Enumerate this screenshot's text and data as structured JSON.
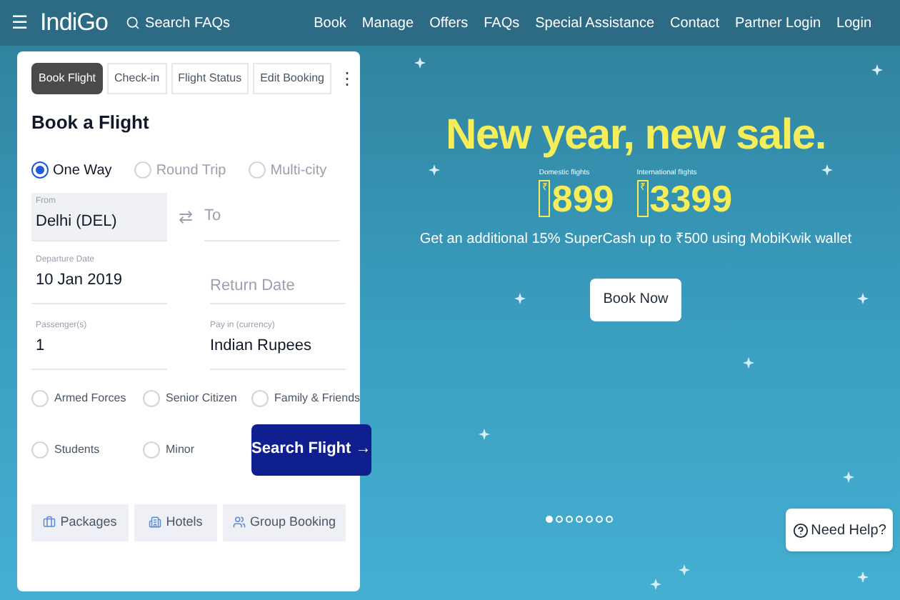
{
  "header": {
    "menu": "☰",
    "logo": "IndiGo",
    "search": "Search FAQs",
    "nav": [
      "Book",
      "Manage",
      "Offers",
      "FAQs",
      "Special Assistance",
      "Contact",
      "Partner Login",
      "Login"
    ]
  },
  "booking": {
    "tabs": [
      {
        "label": "Book Flight",
        "selected": true
      },
      {
        "label": "Check-in",
        "selected": false
      },
      {
        "label": "Flight Status",
        "selected": false
      },
      {
        "label": "Edit Booking",
        "selected": false
      }
    ],
    "more": "⋮",
    "title": "Book a Flight",
    "trip_types": [
      {
        "label": "One Way",
        "selected": true
      },
      {
        "label": "Round Trip",
        "selected": false
      },
      {
        "label": "Multi-city",
        "selected": false
      }
    ],
    "from": {
      "label": "From",
      "value": "Delhi (DEL)"
    },
    "swap": "⇄",
    "to": {
      "placeholder": "To"
    },
    "departure": {
      "label": "Departure Date",
      "value": "10 Jan 2019"
    },
    "return": {
      "placeholder": "Return Date"
    },
    "passengers": {
      "label": "Passenger(s)",
      "value": "1"
    },
    "currency": {
      "label": "Pay in (currency)",
      "value": "Indian Rupees"
    },
    "fare_types": [
      {
        "label": "Armed Forces",
        "selected": false
      },
      {
        "label": "Senior Citizen",
        "selected": false
      },
      {
        "label": "Family & Friends",
        "selected": false
      },
      {
        "label": "Students",
        "selected": false
      },
      {
        "label": "Minor",
        "selected": false
      }
    ],
    "search_button": "Search Flight →",
    "links": [
      {
        "label": "Packages",
        "kind": "suitcase"
      },
      {
        "label": "Hotels",
        "kind": "building"
      },
      {
        "label": "Group Booking",
        "kind": "group"
      }
    ]
  },
  "banner": {
    "headline": "New year, new sale.",
    "prices": [
      {
        "caption": "Domestic flights",
        "currency": "₹",
        "amount": "899"
      },
      {
        "caption": "International flights",
        "currency": "₹",
        "amount": "3399"
      }
    ],
    "offer": "Get an additional 15% SuperCash up to ₹500 using MobiKwik wallet",
    "cta": "Book Now",
    "dots": [
      {
        "selected": true
      },
      {
        "selected": false
      },
      {
        "selected": false
      },
      {
        "selected": false
      },
      {
        "selected": false
      },
      {
        "selected": false
      },
      {
        "selected": false
      }
    ]
  },
  "help": "Need Help?"
}
